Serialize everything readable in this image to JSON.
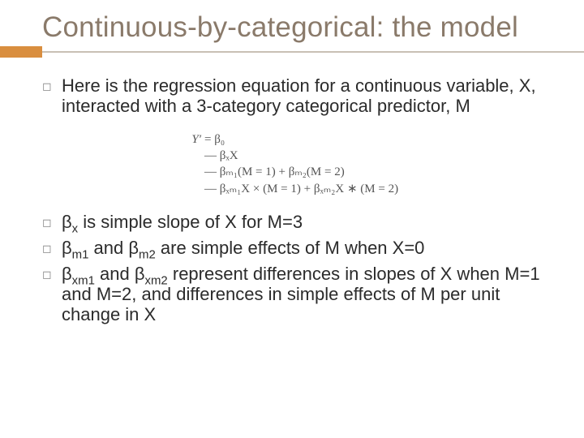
{
  "title": "Continuous-by-categorical: the model",
  "bullets_top": [
    "Here is the regression equation for a continuous variable, X, interacted with a 3-category categorical predictor, M"
  ],
  "equation": {
    "line1_lhs": "Y′",
    "line1_rhs": "= β₀",
    "line2_rhs": "— βₓX",
    "line3_rhs": "— βₘ₁(M = 1) + βₘ₂(M = 2)",
    "line4_rhs": "— βₓₘ₁X × (M = 1) + βₓₘ₂X ∗ (M = 2)"
  },
  "bullets_bottom": [
    {
      "pre": "β",
      "sub": "x",
      "post": " is simple slope of X for M=3"
    },
    {
      "pre": "β",
      "sub": "m1",
      "mid": " and β",
      "sub2": "m2",
      "post": " are simple effects of M when X=0"
    },
    {
      "pre": "β",
      "sub": "xm1",
      "mid": " and β",
      "sub2": "xm2",
      "post": " represent differences in slopes of X when M=1 and M=2, and differences in simple effects of M per unit change in X"
    }
  ]
}
